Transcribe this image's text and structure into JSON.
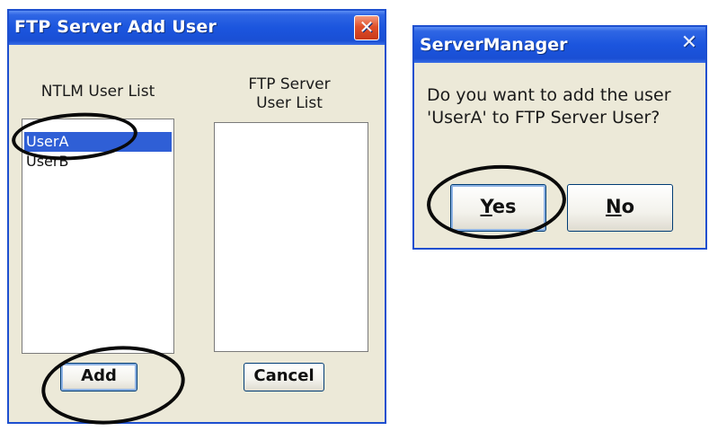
{
  "ftp_add_user_window": {
    "title": "FTP Server Add User",
    "close_glyph": "✕",
    "ntlm_list_label": "NTLM User List",
    "ftp_list_label_line1": "FTP Server",
    "ftp_list_label_line2": "User List",
    "ntlm_users": [
      "UserA",
      "UserB"
    ],
    "selected_user": "UserA",
    "ftp_users": [],
    "add_button_label": "Add",
    "cancel_button_label": "Cancel"
  },
  "server_manager_dialog": {
    "title": "ServerManager",
    "close_glyph": "✕",
    "message": "Do you want to add the user 'UserA' to FTP Server User?",
    "yes_button_label": "Yes",
    "no_button_label": "No"
  },
  "highlights": [
    "UserA",
    "Add",
    "Yes"
  ],
  "colors": {
    "titlebar_blue": "#1b55de",
    "selection_blue": "#2f5fd6",
    "close_red": "#e0502a",
    "window_face": "#ece9d8"
  }
}
